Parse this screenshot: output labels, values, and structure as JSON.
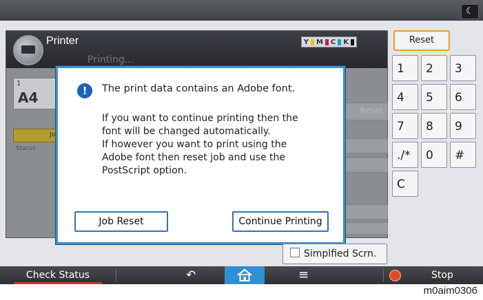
{
  "printer": {
    "title": "Printer",
    "status_text": "Printing...",
    "toner_label": "Y M C K",
    "paper_size": "A4",
    "tray_label": "1",
    "job_label": "Job",
    "status_label": "Status",
    "ghost_reset": "Reset"
  },
  "dialog": {
    "title": "The print data contains an Adobe font.",
    "body": "If you want to continue printing then the\nfont will be changed automatically.\nIf however you want to print using the\nAdobe font then reset job and use the\nPostScript option.",
    "job_reset": "Job Reset",
    "continue_printing": "Continue Printing"
  },
  "keypad": {
    "reset": "Reset",
    "keys": [
      "1",
      "2",
      "3",
      "4",
      "5",
      "6",
      "7",
      "8",
      "9",
      "./*",
      "0",
      "#",
      "C"
    ]
  },
  "simplified": "Simplfied Scrn.",
  "bottom": {
    "check_status": "Check Status",
    "stop": "Stop"
  },
  "caption": "m0aim0306",
  "colors": {
    "accent_blue": "#2e8fd3",
    "reset_border": "#f39a2a",
    "stop_red": "#e34a2a"
  }
}
